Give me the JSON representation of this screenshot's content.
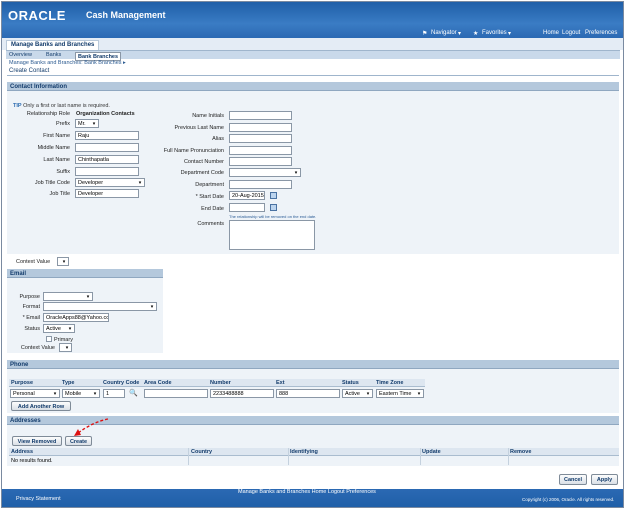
{
  "header": {
    "logo": "ORACLE",
    "app": "Cash Management",
    "navigator": "Navigator",
    "favorites": "Favorites",
    "home": "Home",
    "logout": "Logout",
    "preferences": "Preferences"
  },
  "tabs": {
    "main": "Manage Banks and Branches",
    "sub": [
      "Overview",
      "Banks",
      "Bank Branches"
    ]
  },
  "breadcrumb": "Manage Banks and Branches: Bank Branches",
  "breadcrumb_arrow": "▸",
  "page_title": "Create Contact",
  "contact": {
    "section": "Contact Information",
    "tip": "Only a first or last name is required.",
    "tip_label": "TIP",
    "relationship_role_label": "Relationship Role",
    "relationship_role_value": "Organization Contacts",
    "prefix_label": "Prefix",
    "prefix_value": "Mr.",
    "first_name_label": "First Name",
    "first_name_value": "Raju",
    "middle_name_label": "Middle Name",
    "middle_name_value": "",
    "last_name_label": "Last Name",
    "last_name_value": "Chinthapatla",
    "suffix_label": "Suffix",
    "suffix_value": "",
    "job_title_code_label": "Job Title Code",
    "job_title_code_value": "Developer",
    "job_title_label": "Job Title",
    "job_title_value": "Developer",
    "name_initials_label": "Name Initials",
    "previous_last_name_label": "Previous Last Name",
    "alias_label": "Alias",
    "full_name_pron_label": "Full Name Pronunciation",
    "contact_number_label": "Contact Number",
    "department_code_label": "Department Code",
    "department_label": "Department",
    "start_date_label": "* Start Date",
    "start_date_value": "20-Aug-2015",
    "end_date_label": "End Date",
    "end_date_note": "The relationship will be removed on the end date.",
    "comments_label": "Comments",
    "context_value_label": "Context Value"
  },
  "email": {
    "section": "Email",
    "purpose_label": "Purpose",
    "format_label": "Format",
    "email_label": "* Email",
    "email_value": "OracleApps88@Yahoo.cc",
    "status_label": "Status",
    "status_value": "Active",
    "primary_label": "Primary",
    "context_label": "Context Value"
  },
  "phone": {
    "section": "Phone",
    "headers": [
      "Purpose",
      "Type",
      "Country Code",
      "Area Code",
      "Number",
      "Ext",
      "Status",
      "Time Zone"
    ],
    "row": {
      "purpose": "Personal",
      "type": "Mobile",
      "country_code": "1",
      "area_code": "",
      "number": "2233488888",
      "ext": "888",
      "status": "Active",
      "time_zone": "Eastern Time"
    },
    "add_row": "Add Another Row"
  },
  "addresses": {
    "section": "Addresses",
    "view_removed": "View Removed",
    "create": "Create",
    "headers": [
      "Address",
      "Country",
      "Identifying",
      "Update",
      "Remove"
    ],
    "empty": "No results found."
  },
  "actions": {
    "cancel": "Cancel",
    "apply": "Apply"
  },
  "footer": {
    "privacy": "Privacy Statement",
    "links": "Manage Banks and Branches  Home  Logout  Preferences",
    "copyright": "Copyright (c) 2006, Oracle. All rights reserved."
  }
}
